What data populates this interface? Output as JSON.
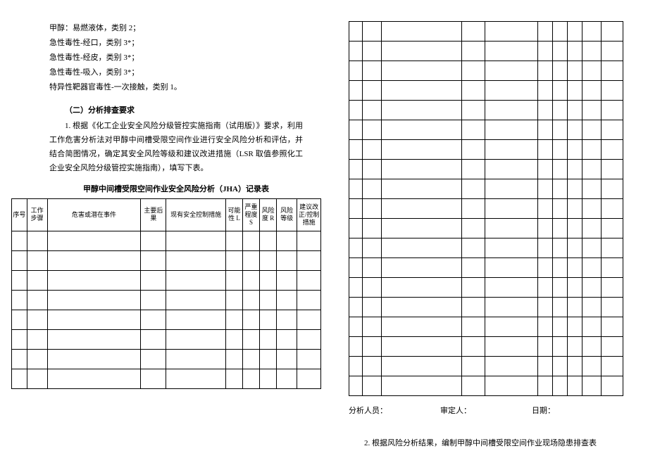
{
  "hazards": {
    "line1": "甲醇：易燃液体，类别 2；",
    "line2": "急性毒性-经口，类别 3*；",
    "line3": "急性毒性-经皮，类别 3*；",
    "line4": "急性毒性-吸入，类别 3*；",
    "line5": "特异性靶器官毒性-一次接触，类别 1。"
  },
  "section": {
    "heading": "（二）分析排查要求",
    "para1": "1. 根据《化工企业安全风险分级管控实施指南（试用版）》要求，利用工作危害分析法对甲醇中间槽受限空间作业进行安全风险分析和评估，并结合简图情况，确定其安全风险等级和建议改进措施（LSR 取值参照化工企业安全风险分级管控实施指南），填写下表。"
  },
  "table": {
    "title": "甲醇中间槽受限空间作业安全风险分析（JHA）记录表",
    "headers": {
      "seq": "序号",
      "step": "工作步骤",
      "hazard": "危害或潜在事件",
      "conseq": "主要后果",
      "control": "现有安全控制措施",
      "l": "可能性 L",
      "s": "严重程度 S",
      "r": "风险度 R",
      "level": "风险等级",
      "suggest": "建议改正/控制措施"
    }
  },
  "signoff": {
    "analyst": "分析人员：",
    "reviewer": "审定人：",
    "date": "日期："
  },
  "next": {
    "text": "2. 根据风险分析结果，编制甲醇中间槽受限空间作业现场隐患排查表"
  }
}
